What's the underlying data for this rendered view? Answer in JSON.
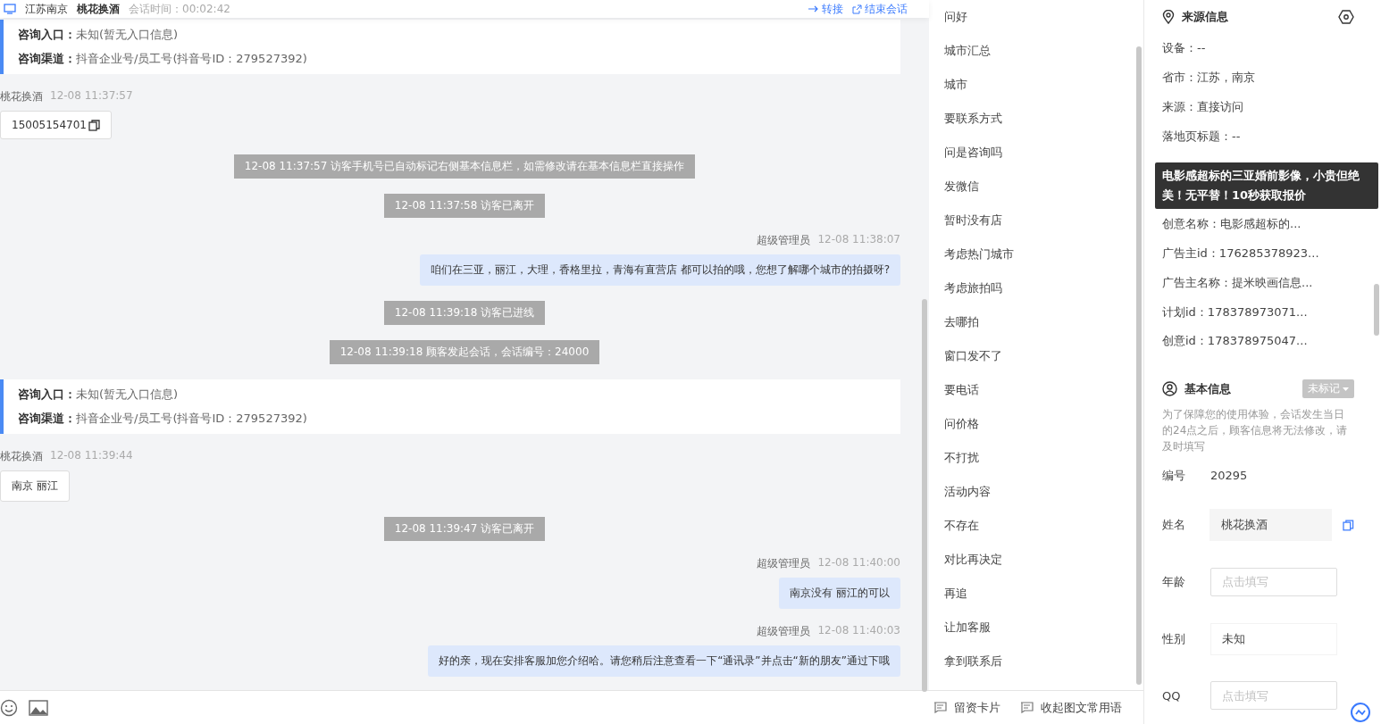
{
  "header": {
    "location": "江苏南京",
    "visitor": "桃花换酒",
    "duration": "会话时间：00:02:42",
    "actions": [
      {
        "kind": "transfer",
        "label": "转接"
      },
      {
        "kind": "end",
        "label": "结束会话"
      }
    ]
  },
  "messages": [
    {
      "kind": "info",
      "rows": [
        {
          "label": "咨询入口：",
          "value": "未知(暂无入口信息)"
        },
        {
          "label": "咨询渠道：",
          "value": "抖音企业号/员工号(抖音号ID：279527392)"
        }
      ]
    },
    {
      "kind": "visitor",
      "name": "桃花换酒",
      "time": "12-08 11:37:57",
      "text": "15005154701",
      "copyable": true
    },
    {
      "kind": "system",
      "text": "12-08 11:37:57 访客手机号已自动标记右侧基本信息栏，如需修改请在基本信息栏直接操作"
    },
    {
      "kind": "system",
      "text": "12-08 11:37:58 访客已离开"
    },
    {
      "kind": "agent",
      "name": "超级管理员",
      "time": "12-08 11:38:07",
      "text": "咱们在三亚，丽江，大理，香格里拉，青海有直营店 都可以拍的哦，您想了解哪个城市的拍摄呀?"
    },
    {
      "kind": "system",
      "text": "12-08 11:39:18 访客已进线"
    },
    {
      "kind": "system",
      "text": "12-08 11:39:18 顾客发起会话，会话编号：24000"
    },
    {
      "kind": "info",
      "rows": [
        {
          "label": "咨询入口：",
          "value": "未知(暂无入口信息)"
        },
        {
          "label": "咨询渠道：",
          "value": "抖音企业号/员工号(抖音号ID：279527392)"
        }
      ]
    },
    {
      "kind": "visitor",
      "name": "桃花换酒",
      "time": "12-08 11:39:44",
      "text": "南京 丽江",
      "copyable": false
    },
    {
      "kind": "system",
      "text": "12-08 11:39:47 访客已离开"
    },
    {
      "kind": "agent",
      "name": "超级管理员",
      "time": "12-08 11:40:00",
      "text": "南京没有 丽江的可以"
    },
    {
      "kind": "agent",
      "name": "超级管理员",
      "time": "12-08 11:40:03",
      "text": "好的亲，现在安排客服加您介绍哈。请您稍后注意查看一下“通讯录”并点击“新的朋友”通过下哦"
    }
  ],
  "phrases": [
    "问好",
    "城市汇总",
    "城市",
    "要联系方式",
    "问是咨询吗",
    "发微信",
    "暂时没有店",
    "考虑热门城市",
    "考虑旅拍吗",
    "去哪拍",
    "窗口发不了",
    "要电话",
    "问价格",
    "不打扰",
    "活动内容",
    "不存在",
    "对比再决定",
    "再追",
    "让加客服",
    "拿到联系后"
  ],
  "toolbar": {
    "buttons": [
      "留资卡片",
      "收起图文常用语"
    ]
  },
  "source": {
    "title": "来源信息",
    "rows": [
      "设备：--",
      "省市：江苏，南京",
      "来源：直接访问",
      "落地页标题：--",
      "创意名称：电影感超标的...",
      "广告主id：176285378923...",
      "广告主名称：提米映画信息...",
      "计划id：178378973071...",
      "创意id：178378975047..."
    ],
    "tooltip": "电影感超标的三亚婚前影像，小贵但绝美！无平替！10秒获取报价"
  },
  "basic": {
    "title": "基本信息",
    "mark": "未标记",
    "note": "为了保障您的使用体验，会话发生当日的24点之后，顾客信息将无法修改，请及时填写",
    "id_label": "编号",
    "id_value": "20295",
    "fields": [
      {
        "label": "姓名",
        "kind": "filled",
        "value": "桃花换酒",
        "copyable": true
      },
      {
        "label": "年龄",
        "kind": "input",
        "placeholder": "点击填写"
      },
      {
        "label": "性别",
        "kind": "filled",
        "value": "未知",
        "copyable": false
      },
      {
        "label": "QQ",
        "kind": "input",
        "placeholder": "点击填写"
      }
    ]
  }
}
